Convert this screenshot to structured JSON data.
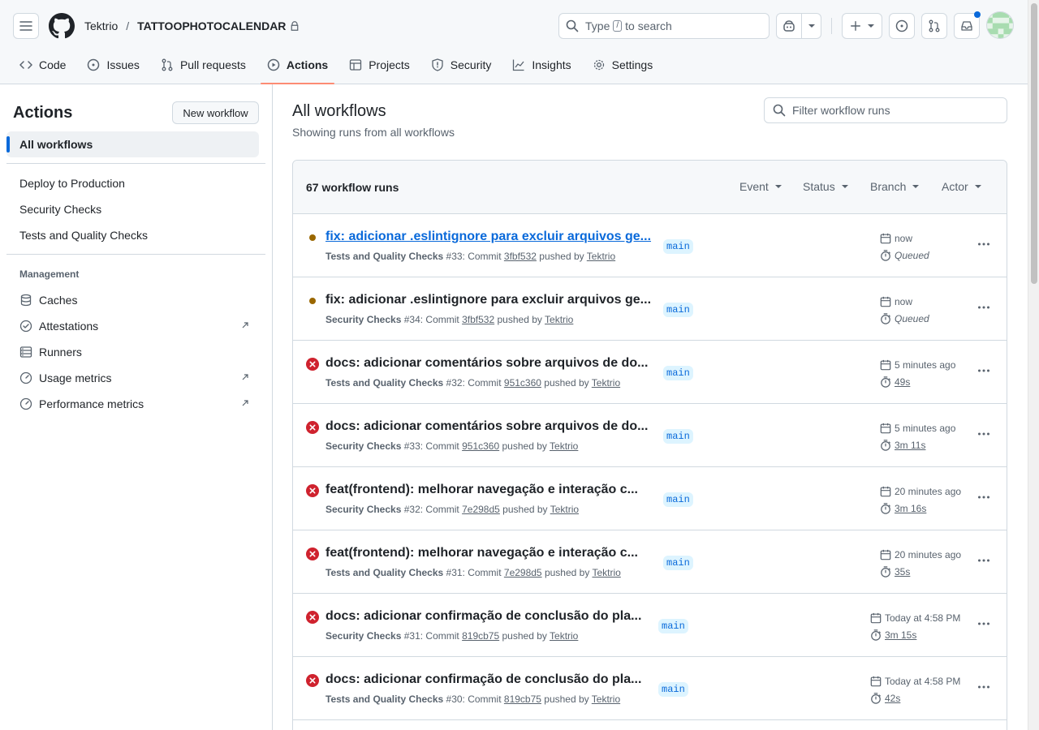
{
  "header": {
    "owner": "Tektrio",
    "separator": "/",
    "repo": "TATTOOPHOTOCALENDAR",
    "search_prefix": "Type",
    "search_key": "/",
    "search_suffix": "to search"
  },
  "tabs": [
    {
      "label": "Code",
      "icon": "code-icon",
      "active": false
    },
    {
      "label": "Issues",
      "icon": "issue-icon",
      "active": false
    },
    {
      "label": "Pull requests",
      "icon": "pull-request-icon",
      "active": false
    },
    {
      "label": "Actions",
      "icon": "play-icon",
      "active": true
    },
    {
      "label": "Projects",
      "icon": "table-icon",
      "active": false
    },
    {
      "label": "Security",
      "icon": "shield-icon",
      "active": false
    },
    {
      "label": "Insights",
      "icon": "graph-icon",
      "active": false
    },
    {
      "label": "Settings",
      "icon": "gear-icon",
      "active": false
    }
  ],
  "sidebar": {
    "title": "Actions",
    "new_workflow": "New workflow",
    "all_workflows": "All workflows",
    "workflows": [
      "Deploy to Production",
      "Security Checks",
      "Tests and Quality Checks"
    ],
    "management_label": "Management",
    "management": [
      {
        "label": "Caches",
        "icon": "database-icon",
        "external": false
      },
      {
        "label": "Attestations",
        "icon": "verified-icon",
        "external": true
      },
      {
        "label": "Runners",
        "icon": "server-icon",
        "external": false
      },
      {
        "label": "Usage metrics",
        "icon": "meter-icon",
        "external": true
      },
      {
        "label": "Performance metrics",
        "icon": "meter-icon",
        "external": true
      }
    ]
  },
  "main": {
    "title": "All workflows",
    "subtitle": "Showing runs from all workflows",
    "filter_placeholder": "Filter workflow runs",
    "count": "67 workflow runs",
    "filters": [
      "Event",
      "Status",
      "Branch",
      "Actor"
    ]
  },
  "runs": [
    {
      "status": "queued",
      "title": "fix: adicionar .eslintignore para excluir arquivos ge...",
      "workflow": "Tests and Quality Checks",
      "number": "#33",
      "commit_label": ": Commit",
      "sha": "3fbf532",
      "pushed_by": "pushed by",
      "user": "Tektrio",
      "branch": "main",
      "when": "now",
      "duration": "Queued"
    },
    {
      "status": "queued",
      "title": "fix: adicionar .eslintignore para excluir arquivos ge...",
      "workflow": "Security Checks",
      "number": "#34",
      "commit_label": ": Commit",
      "sha": "3fbf532",
      "pushed_by": "pushed by",
      "user": "Tektrio",
      "branch": "main",
      "when": "now",
      "duration": "Queued"
    },
    {
      "status": "failure",
      "title": "docs: adicionar comentários sobre arquivos de do...",
      "workflow": "Tests and Quality Checks",
      "number": "#32",
      "commit_label": ": Commit",
      "sha": "951c360",
      "pushed_by": "pushed by",
      "user": "Tektrio",
      "branch": "main",
      "when": "5 minutes ago",
      "duration": "49s"
    },
    {
      "status": "failure",
      "title": "docs: adicionar comentários sobre arquivos de do...",
      "workflow": "Security Checks",
      "number": "#33",
      "commit_label": ": Commit",
      "sha": "951c360",
      "pushed_by": "pushed by",
      "user": "Tektrio",
      "branch": "main",
      "when": "5 minutes ago",
      "duration": "3m 11s"
    },
    {
      "status": "failure",
      "title": "feat(frontend): melhorar navegação e interação c...",
      "workflow": "Security Checks",
      "number": "#32",
      "commit_label": ": Commit",
      "sha": "7e298d5",
      "pushed_by": "pushed by",
      "user": "Tektrio",
      "branch": "main",
      "when": "20 minutes ago",
      "duration": "3m 16s"
    },
    {
      "status": "failure",
      "title": "feat(frontend): melhorar navegação e interação c...",
      "workflow": "Tests and Quality Checks",
      "number": "#31",
      "commit_label": ": Commit",
      "sha": "7e298d5",
      "pushed_by": "pushed by",
      "user": "Tektrio",
      "branch": "main",
      "when": "20 minutes ago",
      "duration": "35s"
    },
    {
      "status": "failure",
      "title": "docs: adicionar confirmação de conclusão do pla...",
      "workflow": "Security Checks",
      "number": "#31",
      "commit_label": ": Commit",
      "sha": "819cb75",
      "pushed_by": "pushed by",
      "user": "Tektrio",
      "branch": "main",
      "when": "Today at 4:58 PM",
      "duration": "3m 15s"
    },
    {
      "status": "failure",
      "title": "docs: adicionar confirmação de conclusão do pla...",
      "workflow": "Tests and Quality Checks",
      "number": "#30",
      "commit_label": ": Commit",
      "sha": "819cb75",
      "pushed_by": "pushed by",
      "user": "Tektrio",
      "branch": "main",
      "when": "Today at 4:58 PM",
      "duration": "42s"
    }
  ],
  "colors": {
    "accent": "#0969da",
    "failure": "#cf222e",
    "queued": "#9a6700",
    "tab_underline": "#fd8c73",
    "border": "#d1d9e0"
  }
}
